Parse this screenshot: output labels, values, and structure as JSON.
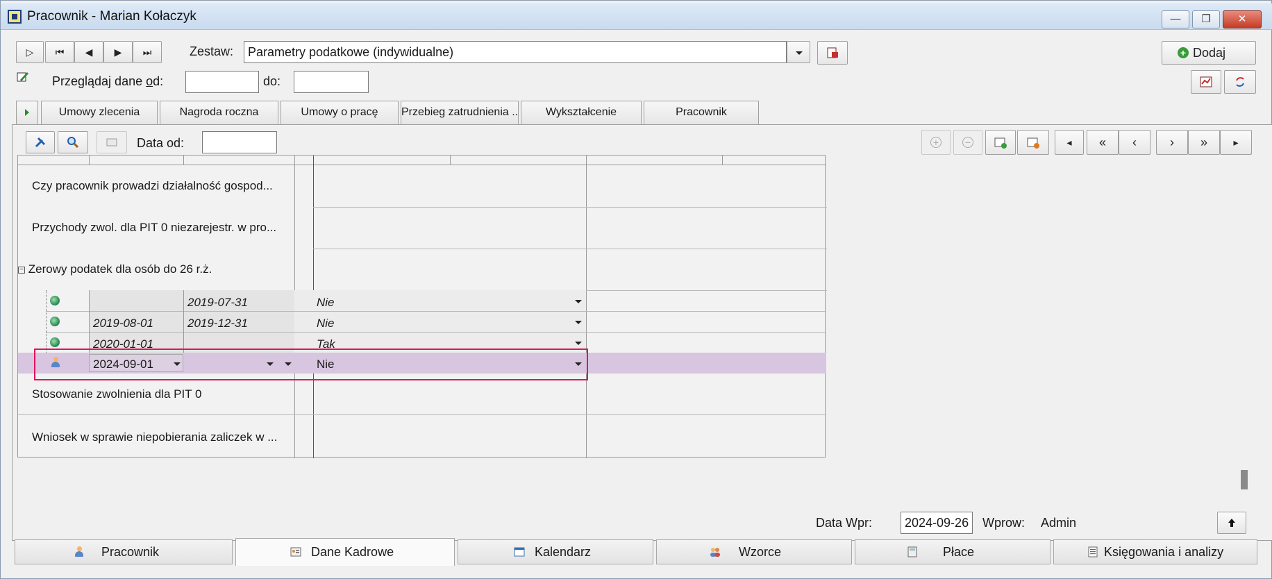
{
  "window": {
    "title": "Pracownik - Marian Kołaczyk",
    "controls": [
      "—",
      "❐",
      "✕"
    ]
  },
  "toolbar": {
    "nav_buttons": [
      "▷",
      "⏮",
      "◀",
      "▶",
      "⏭"
    ],
    "zestaw_label": "Zestaw:",
    "zestaw_value": "Parametry podatkowe (indywidualne)",
    "add_label": "Dodaj",
    "przegladaj_label_pre": "Przeglądaj dane ",
    "przegladaj_label_u": "o",
    "przegladaj_label_post": "d:",
    "od_value": "",
    "do_label": "do:",
    "do_value": ""
  },
  "tabs": [
    {
      "label": "Umowy zlecenia"
    },
    {
      "label": "Nagroda roczna"
    },
    {
      "label": "Umowy o pracę"
    },
    {
      "label": "Przebieg zatrudnienia ..."
    },
    {
      "label": "Wykształcenie"
    },
    {
      "label": "Pracownik"
    }
  ],
  "panel_toolbar": {
    "data_od_label": "Data od:",
    "data_od_value": "",
    "nav_right": [
      "◂",
      "«",
      "‹",
      "›",
      "»",
      "▸"
    ]
  },
  "grid": {
    "rows": [
      {
        "label": "Czy pracownik prowadzi działalność gospod..."
      },
      {
        "label": "Przychody zwol. dla PIT 0 niezarejestr. w pro..."
      },
      {
        "label": "Zerowy podatek dla osób do 26 r.ż."
      },
      {
        "label": "Stosowanie zwolnienia dla PIT 0"
      },
      {
        "label": "Wniosek w sprawie niepobierania zaliczek w ..."
      }
    ],
    "sub_rows": [
      {
        "from": "",
        "to": "2019-07-31",
        "value": "Nie"
      },
      {
        "from": "2019-08-01",
        "to": "2019-12-31",
        "value": "Nie"
      },
      {
        "from": "2020-01-01",
        "to": "",
        "value": "Tak"
      },
      {
        "from": "2024-09-01",
        "to": "",
        "value": "Nie"
      }
    ],
    "highlight_color": "#d8c5df",
    "selection_border_color": "#e0145a"
  },
  "footer": {
    "data_wpr_label": "Data Wpr:",
    "data_wpr_value": "2024-09-26",
    "wprow_label": "Wprow:",
    "wprow_value": "Admin"
  },
  "bottom_tabs": [
    {
      "label": "Pracownik",
      "icon": "person-icon"
    },
    {
      "label": "Dane Kadrowe",
      "icon": "id-card-icon"
    },
    {
      "label": "Kalendarz",
      "icon": "calendar-icon"
    },
    {
      "label": "Wzorce",
      "icon": "people-icon"
    },
    {
      "label": "Płace",
      "icon": "calculator-icon"
    },
    {
      "label": "Księgowania i analizy",
      "icon": "ledger-icon"
    }
  ],
  "active_bottom_tab": "Dane Kadrowe"
}
